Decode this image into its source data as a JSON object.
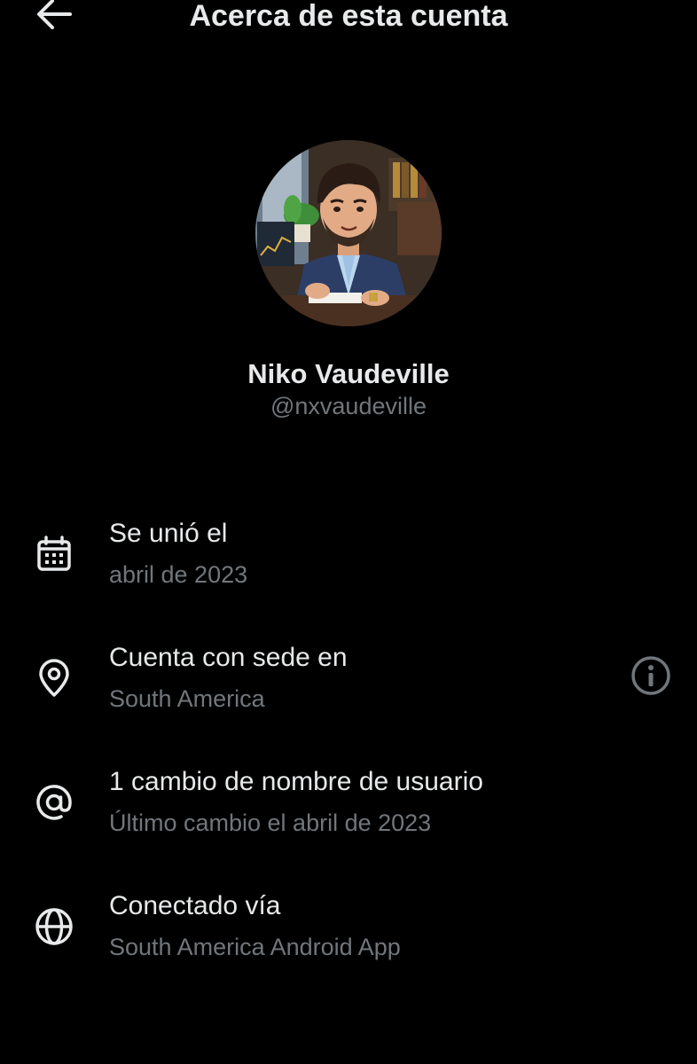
{
  "header": {
    "title": "Acerca de esta cuenta",
    "back_icon": "arrow-left-icon"
  },
  "profile": {
    "display_name": "Niko Vaudeville",
    "handle": "@nxvaudeville"
  },
  "rows": [
    {
      "icon": "calendar-icon",
      "title": "Se unió el",
      "subtitle": "abril de 2023"
    },
    {
      "icon": "location-pin-icon",
      "title": "Cuenta con sede en",
      "subtitle": "South America",
      "trailing_icon": "info-icon"
    },
    {
      "icon": "at-sign-icon",
      "title": "1 cambio de nombre de usuario",
      "subtitle": "Último cambio el abril de 2023"
    },
    {
      "icon": "globe-icon",
      "title": "Conectado vía",
      "subtitle": "South America Android App"
    }
  ],
  "colors": {
    "background": "#000000",
    "primary_text": "#e7e9ea",
    "secondary_text": "#71767b"
  }
}
